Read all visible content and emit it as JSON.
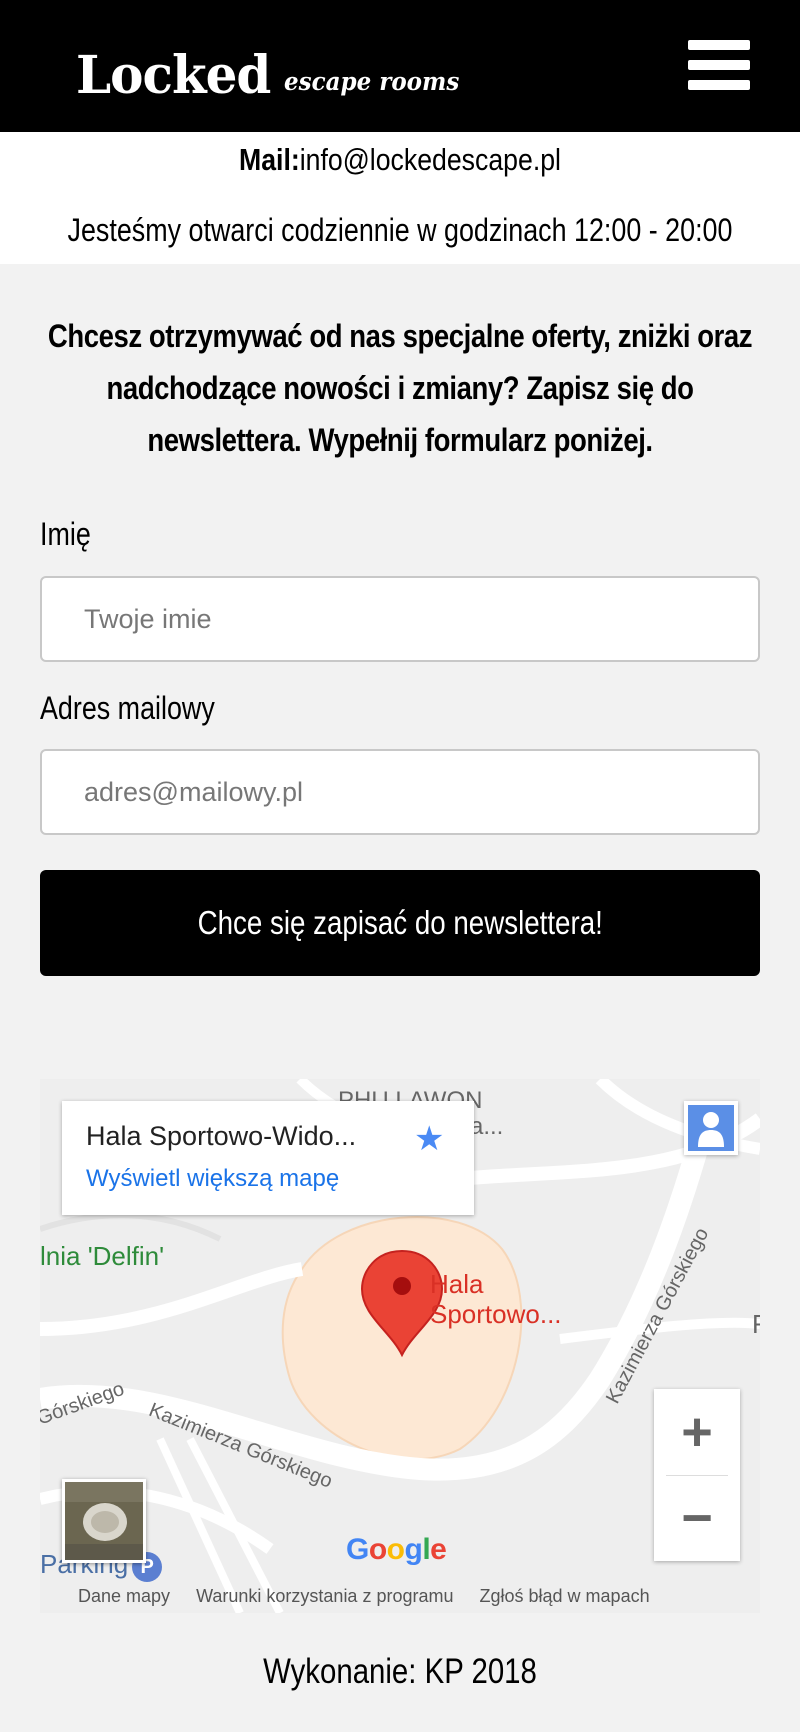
{
  "header": {
    "logo_main": "Locked",
    "logo_sub": "escape rooms",
    "menu_icon": "hamburger-icon"
  },
  "info": {
    "mail_label": "Mail:",
    "mail_value": "info@lockedescape.pl",
    "hours": "Jesteśmy otwarci codziennie w godzinach 12:00 - 20:00"
  },
  "newsletter": {
    "intro": "Chcesz otrzymywać od nas specjalne oferty, zniżki oraz nadchodzące nowości i zmiany? Zapisz się do newslettera. Wypełnij formularz poniżej.",
    "name_label": "Imię",
    "name_placeholder": "Twoje imie",
    "email_label": "Adres mailowy",
    "email_placeholder": "adres@mailowy.pl",
    "submit_label": "Chce się zapisać do newslettera!"
  },
  "map": {
    "place_title": "Hala Sportowo-Wido...",
    "place_link": "Wyświetl większą mapę",
    "star_icon": "star-icon",
    "pegman_icon": "pegman-icon",
    "zoom_in": "+",
    "zoom_out": "−",
    "labels": {
      "delfin": "lnia 'Delfin'",
      "hala_1": "Hala",
      "hala_2": "Sportowo...",
      "phu": "PHU LAWON",
      "phu2": "a...",
      "parking": "Parking",
      "f": "F"
    },
    "streets": {
      "s1": "Kazimierza Górskiego",
      "s2": "Górskiego",
      "s3": "Kazimierza Górskiego"
    },
    "google": "Google",
    "footer": {
      "data": "Dane mapy",
      "terms": "Warunki korzystania z programu",
      "report": "Zgłoś błąd w mapach"
    },
    "colors": {
      "pin": "#ea4335",
      "area": "#fde8d4",
      "link": "#1a73e8"
    }
  },
  "credit": "Wykonanie: KP 2018"
}
